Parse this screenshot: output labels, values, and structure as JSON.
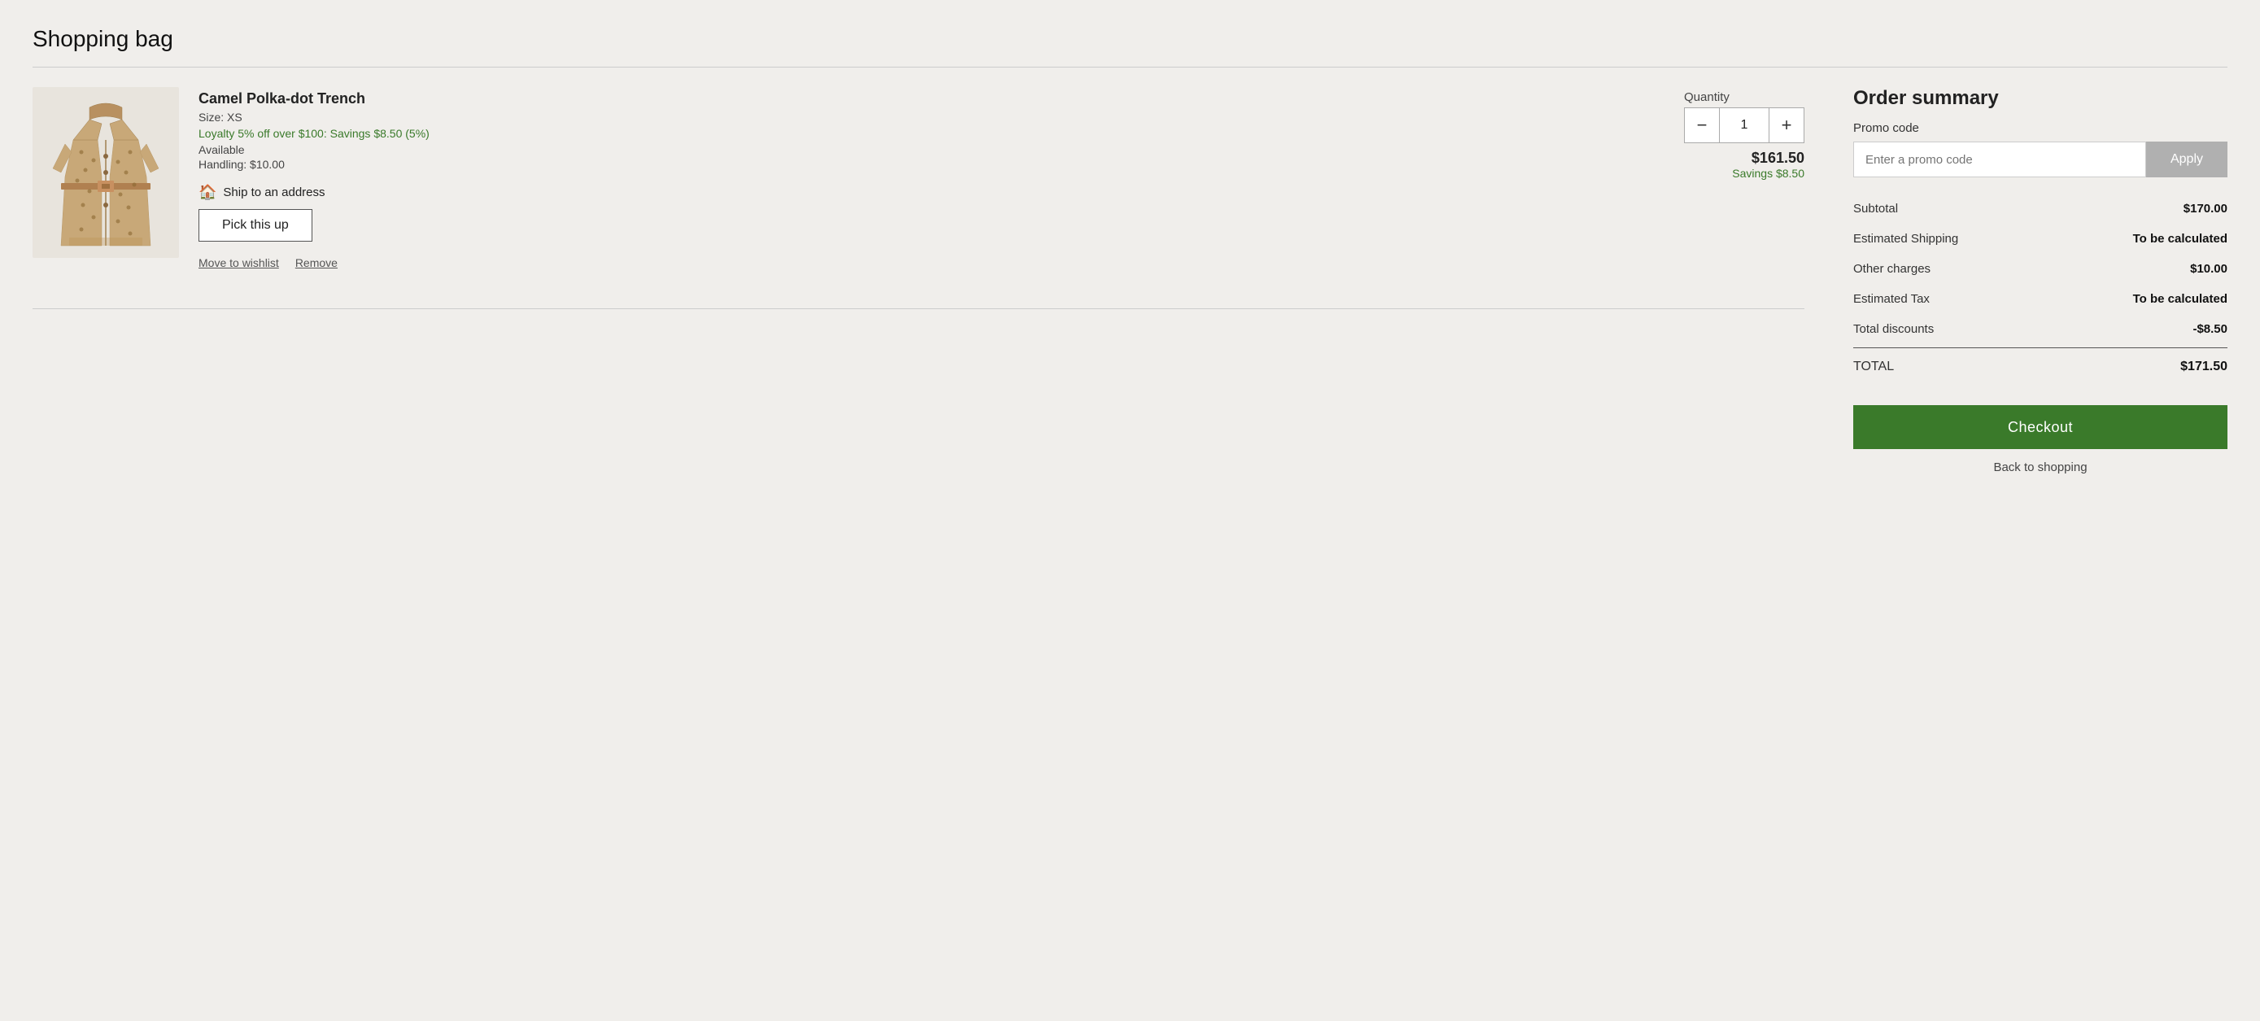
{
  "page": {
    "title": "Shopping bag"
  },
  "cart": {
    "item": {
      "name": "Camel Polka-dot Trench",
      "size_label": "Size: XS",
      "loyalty_text": "Loyalty 5% off over $100: Savings $8.50 (5%)",
      "availability": "Available",
      "handling": "Handling: $10.00",
      "ship_label": "Ship to an address",
      "pickup_label": "Pick this up",
      "move_to_wishlist": "Move to wishlist",
      "remove": "Remove",
      "quantity_label": "Quantity",
      "quantity_value": "1",
      "price": "$161.50",
      "savings": "Savings $8.50",
      "minus_label": "−",
      "plus_label": "+"
    }
  },
  "order_summary": {
    "title": "Order summary",
    "promo_label": "Promo code",
    "promo_placeholder": "Enter a promo code",
    "apply_label": "Apply",
    "rows": [
      {
        "label": "Subtotal",
        "value": "$170.00",
        "bold": true,
        "tbc": false
      },
      {
        "label": "Estimated Shipping",
        "value": "To be calculated",
        "bold": true,
        "tbc": true
      },
      {
        "label": "Other charges",
        "value": "$10.00",
        "bold": true,
        "tbc": false
      },
      {
        "label": "Estimated Tax",
        "value": "To be calculated",
        "bold": true,
        "tbc": true
      },
      {
        "label": "Total discounts",
        "value": "-$8.50",
        "bold": false,
        "tbc": false
      }
    ],
    "total_label": "TOTAL",
    "total_value": "$171.50",
    "checkout_label": "Checkout",
    "back_label": "Back to shopping"
  }
}
